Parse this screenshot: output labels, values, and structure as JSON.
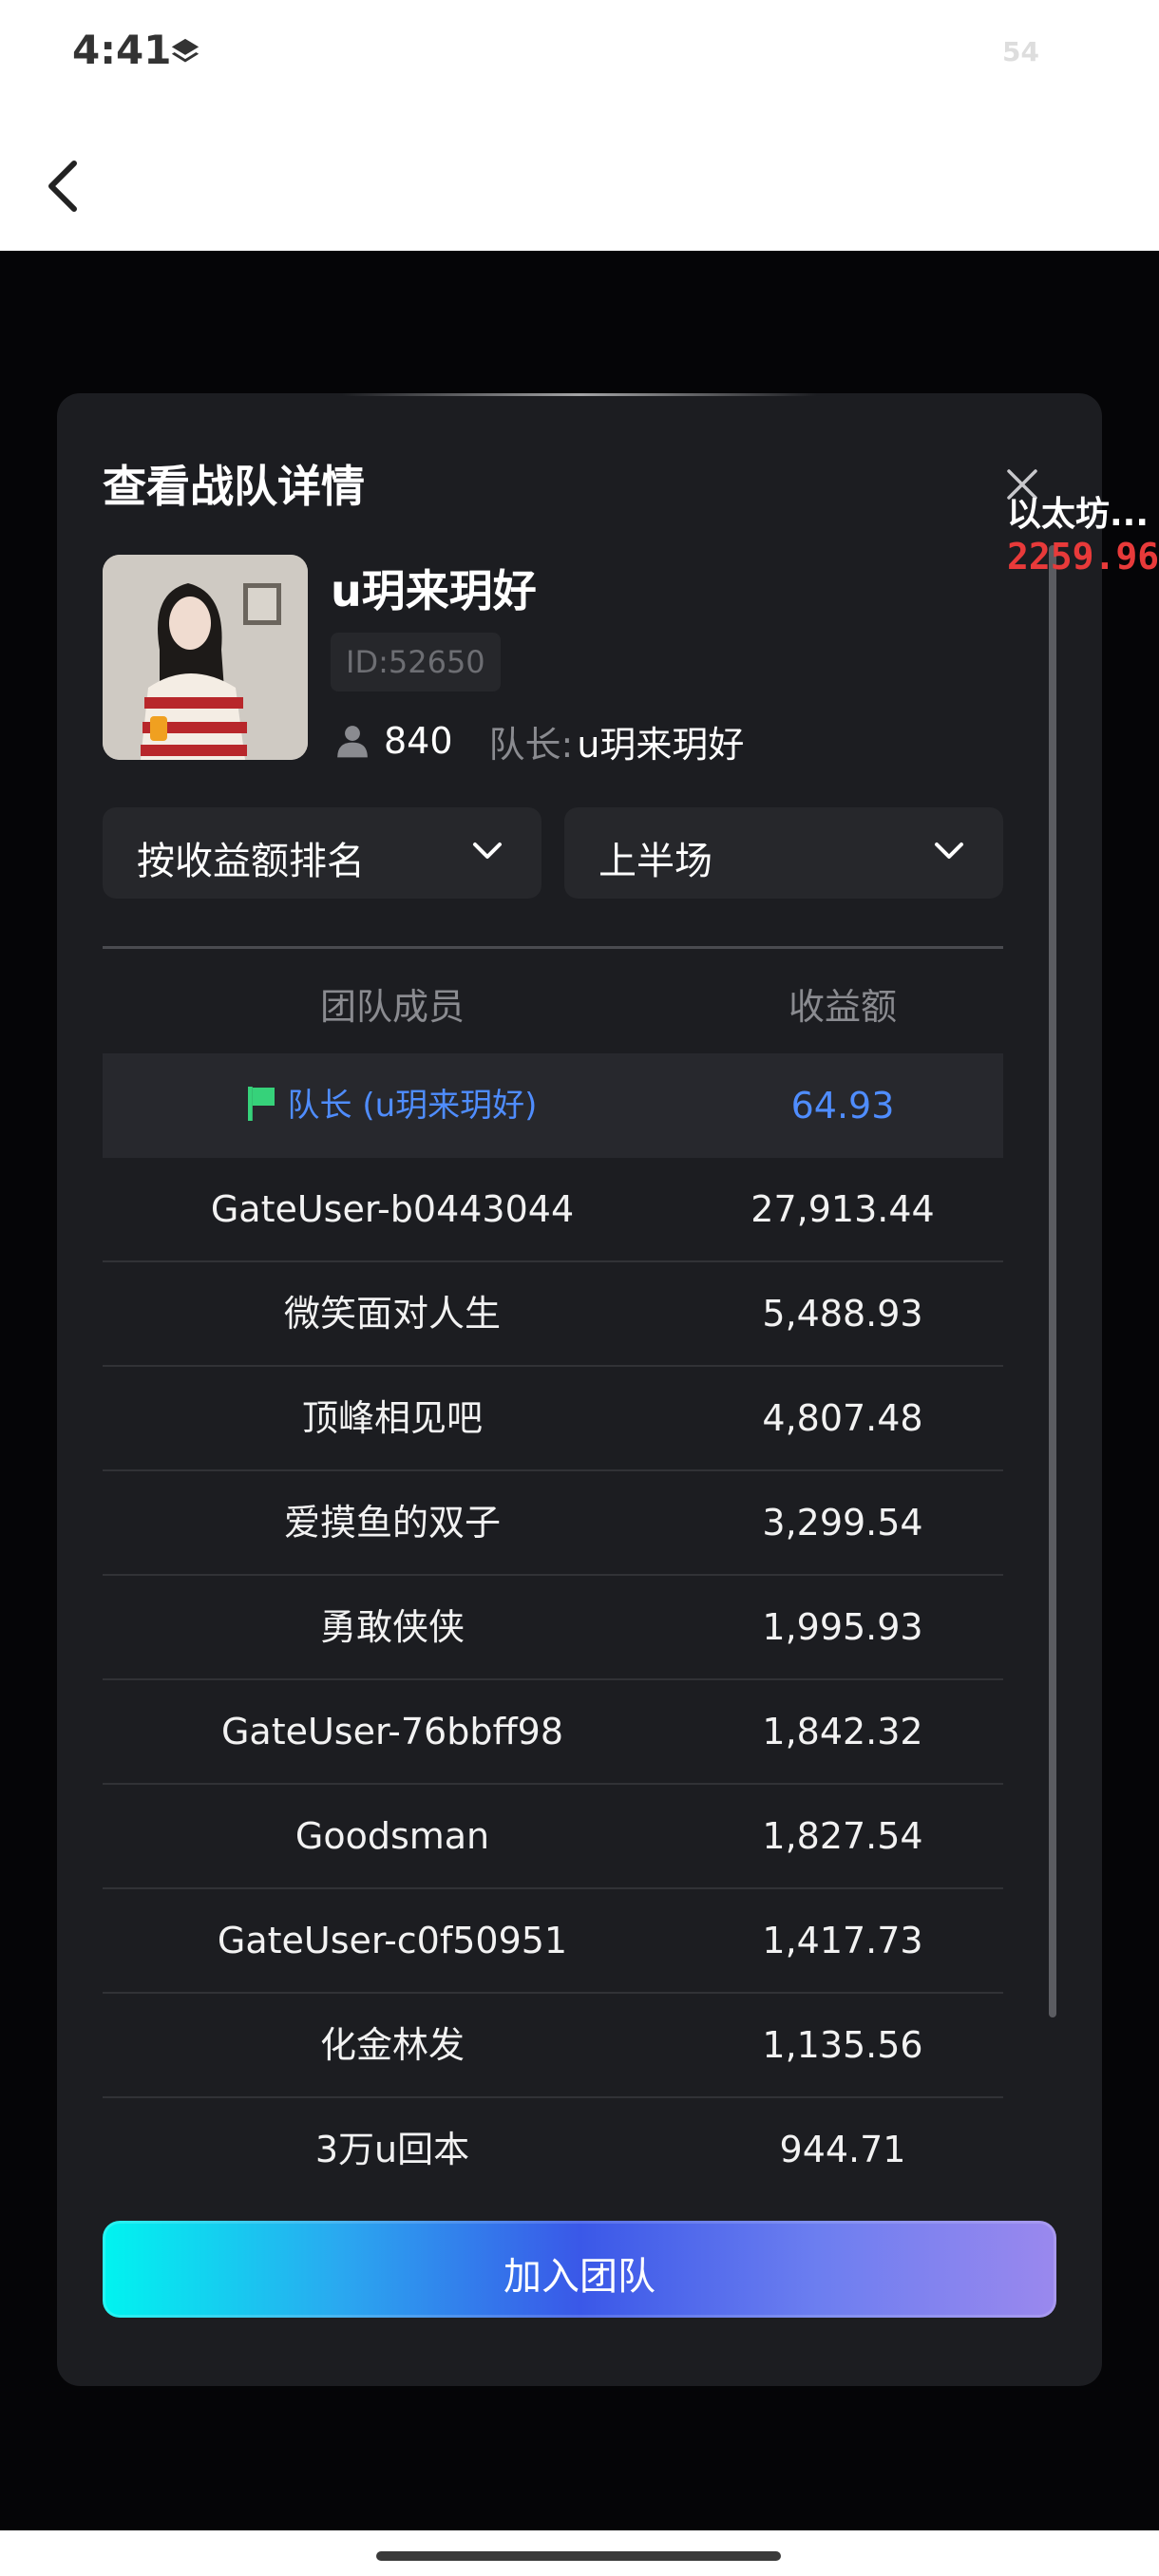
{
  "status_bar": {
    "time": "4:41",
    "battery": "54"
  },
  "dialog": {
    "title": "查看战队详情",
    "team": {
      "name": "u玥来玥好",
      "id_text": "ID:52650",
      "member_count": "840",
      "captain_label": "队长:",
      "captain_name": "u玥来玥好"
    },
    "filters": {
      "sort": "按收益额排名",
      "period": "上半场"
    },
    "table": {
      "headers": [
        "团队成员",
        "收益额"
      ],
      "captain_row": {
        "name": "队长 (u玥来玥好)",
        "value": "64.93"
      },
      "rows": [
        {
          "name": "GateUser-b0443044",
          "value": "27,913.44"
        },
        {
          "name": "微笑面对人生",
          "value": "5,488.93"
        },
        {
          "name": "顶峰相见吧",
          "value": "4,807.48"
        },
        {
          "name": "爱摸鱼的双子",
          "value": "3,299.54"
        },
        {
          "name": "勇敢侠侠",
          "value": "1,995.93"
        },
        {
          "name": "GateUser-76bbff98",
          "value": "1,842.32"
        },
        {
          "name": "Goodsman",
          "value": "1,827.54"
        },
        {
          "name": "GateUser-c0f50951",
          "value": "1,417.73"
        },
        {
          "name": "化金林发",
          "value": "1,135.56"
        },
        {
          "name": "3万u回本",
          "value": "944.71"
        }
      ]
    },
    "join_button": "加入团队"
  },
  "side_overlay": {
    "label": "以太坊...",
    "value": "2259.96"
  },
  "colors": {
    "accent_blue": "#4f8dff",
    "price_red": "#e83a3a",
    "flag_green": "#36d27a"
  }
}
